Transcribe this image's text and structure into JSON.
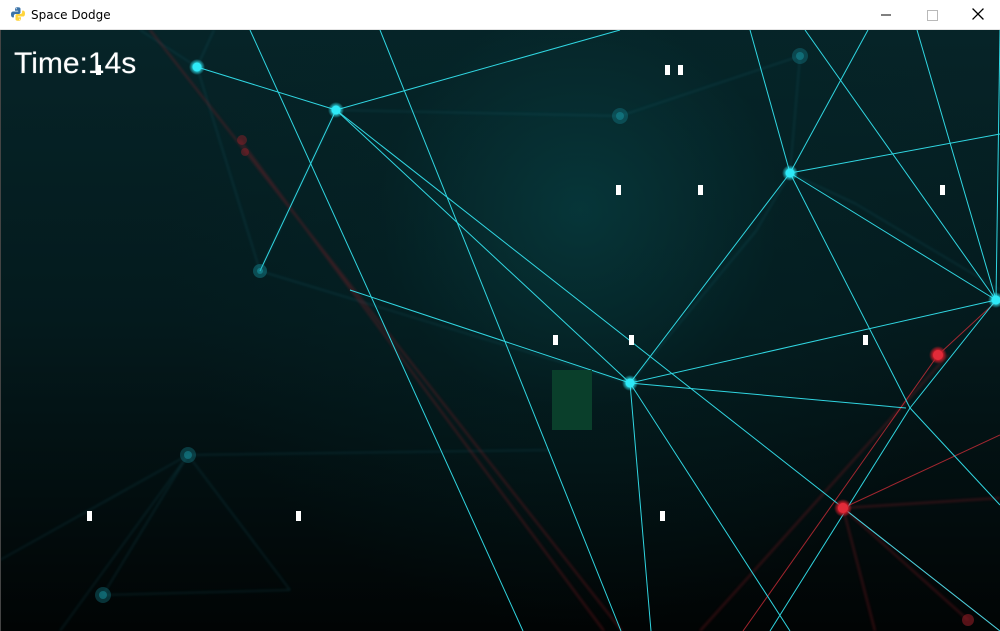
{
  "window": {
    "title": "Space Dodge",
    "icon": "python-icon"
  },
  "titlebar_controls": {
    "minimize_icon": "minimize-icon",
    "maximize_icon": "maximize-icon",
    "close_icon": "close-icon"
  },
  "hud": {
    "time_text": "Time:14s"
  },
  "colors": {
    "titlebar_background": "#ffffff",
    "game_background": "#041a1d",
    "network_cyan": "#34e6f2",
    "network_red": "#d82f3a",
    "player": "#0a3f2b",
    "projectiles": "#ffffff"
  },
  "game": {
    "player_name": "player",
    "projectile_count": 12
  }
}
